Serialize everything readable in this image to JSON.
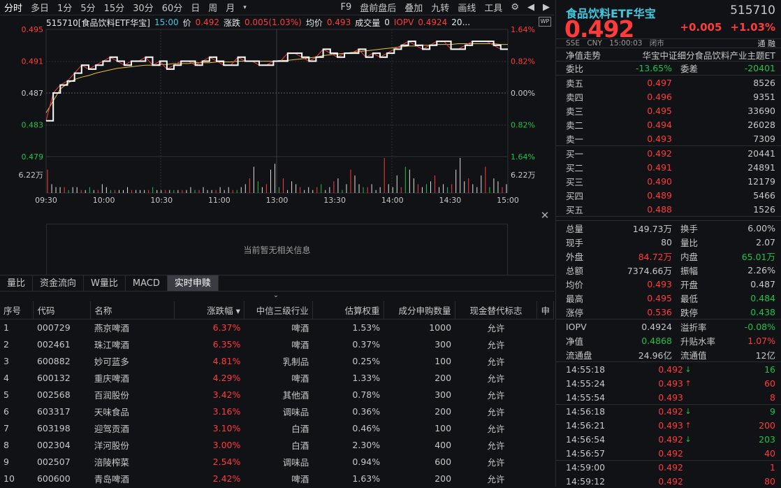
{
  "toolbar": {
    "items": [
      "分时",
      "多日",
      "1分",
      "5分",
      "15分",
      "30分",
      "60分",
      "日",
      "周",
      "月"
    ],
    "right": [
      "F9",
      "盘前盘后",
      "叠加",
      "九转",
      "画线",
      "工具"
    ]
  },
  "info": {
    "code_name": "515710[食品饮料ETF华宝]",
    "time": "15:00",
    "price_label": "价",
    "price": "0.492",
    "chg_label": "涨跌",
    "chg": "0.005(1.03%)",
    "avg_label": "均价",
    "avg": "0.493",
    "vol_label": "成交量",
    "vol": "0",
    "iopv_label": "IOPV",
    "iopv": "0.4924",
    "more": "20..."
  },
  "chart_data": {
    "type": "line",
    "x_ticks": [
      "09:30",
      "10:00",
      "10:30",
      "11:00",
      "13:00",
      "13:30",
      "14:00",
      "14:30",
      "15:00"
    ],
    "y_left": [
      "0.495",
      "0.491",
      "0.487",
      "0.483",
      "0.479"
    ],
    "y_right": [
      "1.64%",
      "0.82%",
      "0.00%",
      "0.82%",
      "1.64%"
    ],
    "vol_label": "6.22万",
    "prev_close": 0.487,
    "ylim": [
      0.479,
      0.495
    ],
    "price": [
      0.4835,
      0.487,
      0.488,
      0.4885,
      0.4895,
      0.4905,
      0.49,
      0.4905,
      0.491,
      0.4915,
      0.491,
      0.4905,
      0.491,
      0.491,
      0.4915,
      0.4905,
      0.491,
      0.49,
      0.4905,
      0.491,
      0.491,
      0.4905,
      0.491,
      0.4915,
      0.491,
      0.4905,
      0.4905,
      0.4915,
      0.491,
      0.491,
      0.4905,
      0.4905,
      0.491,
      0.491,
      0.492,
      0.492,
      0.4915,
      0.491,
      0.4915,
      0.4925,
      0.492,
      0.4915,
      0.492,
      0.492,
      0.4925,
      0.4915,
      0.492,
      0.4915,
      0.492,
      0.4925,
      0.493,
      0.4935,
      0.493,
      0.4925,
      0.493,
      0.4935,
      0.4935,
      0.4925,
      0.4925,
      0.493,
      0.4935,
      0.4935,
      0.4935,
      0.493,
      0.4925,
      0.4925
    ],
    "avg": [
      0.4845,
      0.486,
      0.4875,
      0.4882,
      0.4887,
      0.489,
      0.4892,
      0.4895,
      0.4897,
      0.4899,
      0.4901,
      0.4902,
      0.4903,
      0.4904,
      0.4905,
      0.4905,
      0.4906,
      0.4906,
      0.4907,
      0.4907,
      0.4907,
      0.4908,
      0.4908,
      0.4908,
      0.4909,
      0.4909,
      0.4909,
      0.491,
      0.491,
      0.491,
      0.491,
      0.491,
      0.491,
      0.4911,
      0.4911,
      0.4912,
      0.4913,
      0.4914,
      0.4915,
      0.4917,
      0.4918,
      0.4919,
      0.492,
      0.4921,
      0.4922,
      0.4923,
      0.4924,
      0.4925,
      0.4926,
      0.4927,
      0.4928,
      0.4929,
      0.4929,
      0.493,
      0.493,
      0.4931,
      0.4931,
      0.4931,
      0.4932,
      0.4932,
      0.4932,
      0.4932,
      0.4932,
      0.4932,
      0.4931,
      0.4931
    ],
    "volumes": [
      8,
      3,
      2,
      2,
      2,
      1,
      2,
      2,
      1,
      1,
      2,
      1,
      1,
      3,
      2,
      1,
      1,
      1,
      1,
      2,
      1,
      1,
      1,
      1,
      1,
      2,
      1,
      1,
      1,
      1,
      1,
      1,
      1,
      1,
      2,
      1,
      1,
      2,
      1,
      1,
      1,
      2,
      1,
      2,
      1,
      1,
      2,
      3,
      5,
      9,
      4,
      2,
      3,
      8,
      10,
      2,
      5,
      1,
      4,
      3,
      2,
      1,
      2,
      1,
      2,
      3,
      1,
      2,
      4,
      5,
      1,
      3,
      8,
      6,
      3,
      2,
      2,
      3,
      1,
      2,
      12,
      3,
      2,
      6,
      2,
      9,
      8,
      5,
      3,
      2,
      3,
      4,
      6,
      2,
      3,
      2,
      3,
      8,
      12,
      4,
      5,
      3,
      2,
      6,
      9,
      2,
      5,
      4,
      2,
      3
    ]
  },
  "empty_msg": "当前暂无相关信息",
  "tabs": [
    "量比",
    "资金流向",
    "W量比",
    "MACD",
    "实时申赎"
  ],
  "table": {
    "headers": [
      "序号",
      "代码",
      "名称",
      "涨跌幅 ▾",
      "中信三级行业",
      "估算权重",
      "成分申购数量",
      "现金替代标志",
      "申"
    ],
    "rows": [
      [
        "1",
        "000729",
        "燕京啤酒",
        "6.37%",
        "啤酒",
        "1.53%",
        "1000",
        "允许"
      ],
      [
        "2",
        "002461",
        "珠江啤酒",
        "6.35%",
        "啤酒",
        "0.37%",
        "300",
        "允许"
      ],
      [
        "3",
        "600882",
        "妙可蓝多",
        "4.81%",
        "乳制品",
        "0.25%",
        "100",
        "允许"
      ],
      [
        "4",
        "600132",
        "重庆啤酒",
        "4.29%",
        "啤酒",
        "1.33%",
        "200",
        "允许"
      ],
      [
        "5",
        "002568",
        "百润股份",
        "3.42%",
        "其他酒",
        "0.78%",
        "300",
        "允许"
      ],
      [
        "6",
        "603317",
        "天味食品",
        "3.16%",
        "调味品",
        "0.36%",
        "200",
        "允许"
      ],
      [
        "7",
        "603198",
        "迎驾贡酒",
        "3.10%",
        "白酒",
        "0.46%",
        "100",
        "允许"
      ],
      [
        "8",
        "002304",
        "洋河股份",
        "3.00%",
        "白酒",
        "2.30%",
        "400",
        "允许"
      ],
      [
        "9",
        "002507",
        "涪陵榨菜",
        "2.54%",
        "调味品",
        "0.94%",
        "600",
        "允许"
      ],
      [
        "10",
        "600600",
        "青岛啤酒",
        "2.42%",
        "啤酒",
        "1.63%",
        "200",
        "允许"
      ]
    ]
  },
  "quote": {
    "name": "食品饮料ETF华宝",
    "code": "515710",
    "price": "0.492",
    "chg": "+0.005",
    "pct": "+1.03%",
    "sub": [
      "SSE",
      "CNY",
      "15:00:03",
      "闭市"
    ],
    "flags": "通 融",
    "nav_trend": "净值走势",
    "full_name": "华宝中证细分食品饮料产业主题ET",
    "wb_label": "委比",
    "wb": "-13.65%",
    "wc_label": "委差",
    "wc": "-20401",
    "asks": [
      [
        "卖五",
        "0.497",
        "8526"
      ],
      [
        "卖四",
        "0.496",
        "9351"
      ],
      [
        "卖三",
        "0.495",
        "33690"
      ],
      [
        "卖二",
        "0.494",
        "26028"
      ],
      [
        "卖一",
        "0.493",
        "7309"
      ]
    ],
    "bids": [
      [
        "买一",
        "0.492",
        "20441"
      ],
      [
        "买二",
        "0.491",
        "24891"
      ],
      [
        "买三",
        "0.490",
        "12179"
      ],
      [
        "买四",
        "0.489",
        "5466"
      ],
      [
        "买五",
        "0.488",
        "1526"
      ]
    ],
    "stats": [
      [
        "总量",
        "149.73万",
        "换手",
        "6.00%"
      ],
      [
        "现手",
        "80",
        "量比",
        "2.07"
      ],
      [
        "外盘",
        "84.72万",
        "内盘",
        "65.01万"
      ],
      [
        "总额",
        "7374.66万",
        "振幅",
        "2.26%"
      ],
      [
        "均价",
        "0.493",
        "开盘",
        "0.487"
      ],
      [
        "最高",
        "0.495",
        "最低",
        "0.484"
      ],
      [
        "涨停",
        "0.536",
        "跌停",
        "0.438"
      ]
    ],
    "stats2": [
      [
        "IOPV",
        "0.4924",
        "溢折率",
        "-0.08%"
      ],
      [
        "净值",
        "0.4868",
        "升贴水率",
        "1.07%"
      ],
      [
        "流通盘",
        "24.96亿",
        "流通值",
        "12亿"
      ]
    ],
    "ticks": [
      [
        "14:55:18",
        "0.492",
        "down",
        "16"
      ],
      [
        "14:55:24",
        "0.493",
        "up",
        "60"
      ],
      [
        "14:55:54",
        "0.493",
        "",
        "8"
      ],
      [
        "14:56:18",
        "0.492",
        "down",
        "9"
      ],
      [
        "14:56:21",
        "0.493",
        "up",
        "200"
      ],
      [
        "14:56:54",
        "0.492",
        "down",
        "203"
      ],
      [
        "14:56:57",
        "0.492",
        "",
        "40"
      ],
      [
        "14:59:00",
        "0.492",
        "",
        "1"
      ],
      [
        "14:59:12",
        "0.492",
        "",
        "80"
      ]
    ]
  },
  "colors": {
    "up": "#ff3b3b",
    "down": "#19c44a",
    "accent": "#3fc8e0",
    "avg": "#e8c23a"
  }
}
